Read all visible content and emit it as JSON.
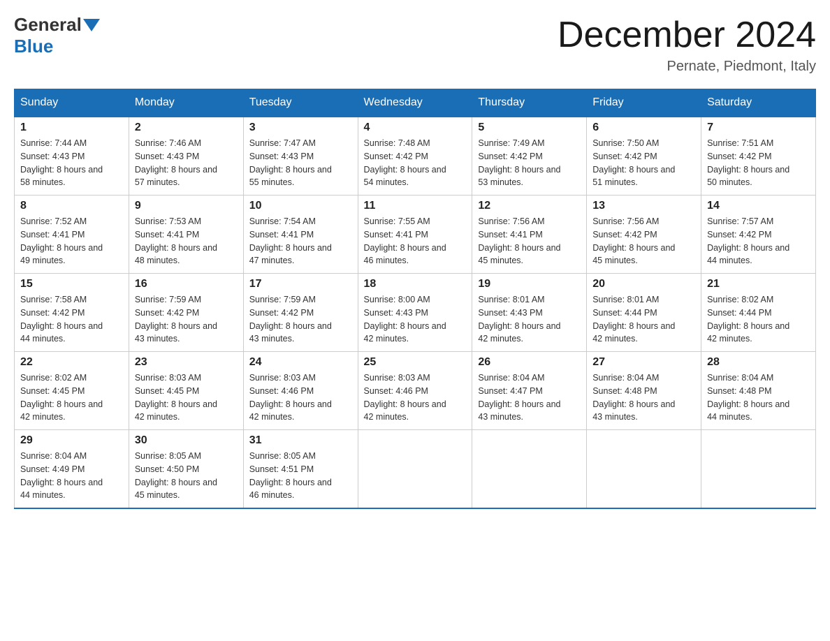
{
  "header": {
    "logo_general": "General",
    "logo_blue": "Blue",
    "month_title": "December 2024",
    "location": "Pernate, Piedmont, Italy"
  },
  "weekdays": [
    "Sunday",
    "Monday",
    "Tuesday",
    "Wednesday",
    "Thursday",
    "Friday",
    "Saturday"
  ],
  "weeks": [
    [
      {
        "day": 1,
        "sunrise": "7:44 AM",
        "sunset": "4:43 PM",
        "daylight": "8 hours and 58 minutes."
      },
      {
        "day": 2,
        "sunrise": "7:46 AM",
        "sunset": "4:43 PM",
        "daylight": "8 hours and 57 minutes."
      },
      {
        "day": 3,
        "sunrise": "7:47 AM",
        "sunset": "4:43 PM",
        "daylight": "8 hours and 55 minutes."
      },
      {
        "day": 4,
        "sunrise": "7:48 AM",
        "sunset": "4:42 PM",
        "daylight": "8 hours and 54 minutes."
      },
      {
        "day": 5,
        "sunrise": "7:49 AM",
        "sunset": "4:42 PM",
        "daylight": "8 hours and 53 minutes."
      },
      {
        "day": 6,
        "sunrise": "7:50 AM",
        "sunset": "4:42 PM",
        "daylight": "8 hours and 51 minutes."
      },
      {
        "day": 7,
        "sunrise": "7:51 AM",
        "sunset": "4:42 PM",
        "daylight": "8 hours and 50 minutes."
      }
    ],
    [
      {
        "day": 8,
        "sunrise": "7:52 AM",
        "sunset": "4:41 PM",
        "daylight": "8 hours and 49 minutes."
      },
      {
        "day": 9,
        "sunrise": "7:53 AM",
        "sunset": "4:41 PM",
        "daylight": "8 hours and 48 minutes."
      },
      {
        "day": 10,
        "sunrise": "7:54 AM",
        "sunset": "4:41 PM",
        "daylight": "8 hours and 47 minutes."
      },
      {
        "day": 11,
        "sunrise": "7:55 AM",
        "sunset": "4:41 PM",
        "daylight": "8 hours and 46 minutes."
      },
      {
        "day": 12,
        "sunrise": "7:56 AM",
        "sunset": "4:41 PM",
        "daylight": "8 hours and 45 minutes."
      },
      {
        "day": 13,
        "sunrise": "7:56 AM",
        "sunset": "4:42 PM",
        "daylight": "8 hours and 45 minutes."
      },
      {
        "day": 14,
        "sunrise": "7:57 AM",
        "sunset": "4:42 PM",
        "daylight": "8 hours and 44 minutes."
      }
    ],
    [
      {
        "day": 15,
        "sunrise": "7:58 AM",
        "sunset": "4:42 PM",
        "daylight": "8 hours and 44 minutes."
      },
      {
        "day": 16,
        "sunrise": "7:59 AM",
        "sunset": "4:42 PM",
        "daylight": "8 hours and 43 minutes."
      },
      {
        "day": 17,
        "sunrise": "7:59 AM",
        "sunset": "4:42 PM",
        "daylight": "8 hours and 43 minutes."
      },
      {
        "day": 18,
        "sunrise": "8:00 AM",
        "sunset": "4:43 PM",
        "daylight": "8 hours and 42 minutes."
      },
      {
        "day": 19,
        "sunrise": "8:01 AM",
        "sunset": "4:43 PM",
        "daylight": "8 hours and 42 minutes."
      },
      {
        "day": 20,
        "sunrise": "8:01 AM",
        "sunset": "4:44 PM",
        "daylight": "8 hours and 42 minutes."
      },
      {
        "day": 21,
        "sunrise": "8:02 AM",
        "sunset": "4:44 PM",
        "daylight": "8 hours and 42 minutes."
      }
    ],
    [
      {
        "day": 22,
        "sunrise": "8:02 AM",
        "sunset": "4:45 PM",
        "daylight": "8 hours and 42 minutes."
      },
      {
        "day": 23,
        "sunrise": "8:03 AM",
        "sunset": "4:45 PM",
        "daylight": "8 hours and 42 minutes."
      },
      {
        "day": 24,
        "sunrise": "8:03 AM",
        "sunset": "4:46 PM",
        "daylight": "8 hours and 42 minutes."
      },
      {
        "day": 25,
        "sunrise": "8:03 AM",
        "sunset": "4:46 PM",
        "daylight": "8 hours and 42 minutes."
      },
      {
        "day": 26,
        "sunrise": "8:04 AM",
        "sunset": "4:47 PM",
        "daylight": "8 hours and 43 minutes."
      },
      {
        "day": 27,
        "sunrise": "8:04 AM",
        "sunset": "4:48 PM",
        "daylight": "8 hours and 43 minutes."
      },
      {
        "day": 28,
        "sunrise": "8:04 AM",
        "sunset": "4:48 PM",
        "daylight": "8 hours and 44 minutes."
      }
    ],
    [
      {
        "day": 29,
        "sunrise": "8:04 AM",
        "sunset": "4:49 PM",
        "daylight": "8 hours and 44 minutes."
      },
      {
        "day": 30,
        "sunrise": "8:05 AM",
        "sunset": "4:50 PM",
        "daylight": "8 hours and 45 minutes."
      },
      {
        "day": 31,
        "sunrise": "8:05 AM",
        "sunset": "4:51 PM",
        "daylight": "8 hours and 46 minutes."
      },
      null,
      null,
      null,
      null
    ]
  ]
}
